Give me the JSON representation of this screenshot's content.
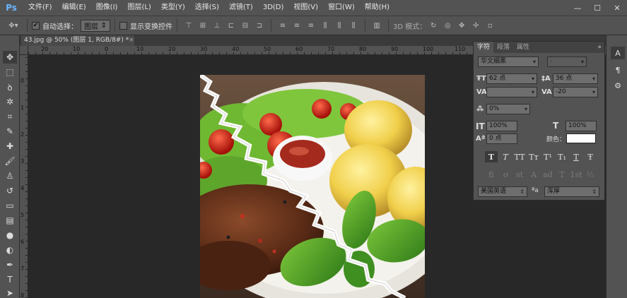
{
  "app": {
    "logo": "Ps"
  },
  "menu": [
    "文件(F)",
    "编辑(E)",
    "图像(I)",
    "图层(L)",
    "类型(Y)",
    "选择(S)",
    "滤镜(T)",
    "3D(D)",
    "视图(V)",
    "窗口(W)",
    "帮助(H)"
  ],
  "window_controls": {
    "minimize": "—",
    "maximize": "☐",
    "close": "✕"
  },
  "options_bar": {
    "auto_select_label": "自动选择：",
    "auto_select_checked": true,
    "auto_select_target": "图层",
    "show_transform_label": "显示变换控件",
    "show_transform_checked": false,
    "mode_3d_label": "3D 模式："
  },
  "document": {
    "tab_title": "43.jpg @ 50% (图层 1, RGB/8#) *",
    "close": "×"
  },
  "rulers": {
    "horizontal": [
      "20",
      "10",
      "0",
      "10",
      "20",
      "30",
      "40",
      "50",
      "60",
      "70",
      "80",
      "90",
      "100",
      "110",
      "120",
      "130",
      "140",
      "150"
    ],
    "vertical": [
      "0",
      "1",
      "2",
      "3",
      "4",
      "5",
      "6",
      "7",
      "8"
    ]
  },
  "character_panel": {
    "tabs": [
      "字符",
      "段落",
      "属性"
    ],
    "menu_icon": "»",
    "font_family": "华文细黑",
    "font_style": "-",
    "font_size": "62 点",
    "leading": "36 点",
    "kerning": "",
    "tracking": "-20",
    "tsume": "0%",
    "vertical_scale": "100%",
    "horizontal_scale": "100%",
    "baseline_shift": "0 点",
    "color_label": "颜色：",
    "color_value": "#ffffff",
    "style_buttons": [
      "T",
      "T",
      "TT",
      "Tт",
      "T¹",
      "T₁",
      "T",
      "Ŧ"
    ],
    "opentype_buttons": [
      "fi",
      "ơ",
      "st",
      "A",
      "ad",
      "T",
      "1st",
      "½"
    ],
    "language": "美国英语",
    "aa_label": "ªa",
    "antialias": "浑厚"
  }
}
